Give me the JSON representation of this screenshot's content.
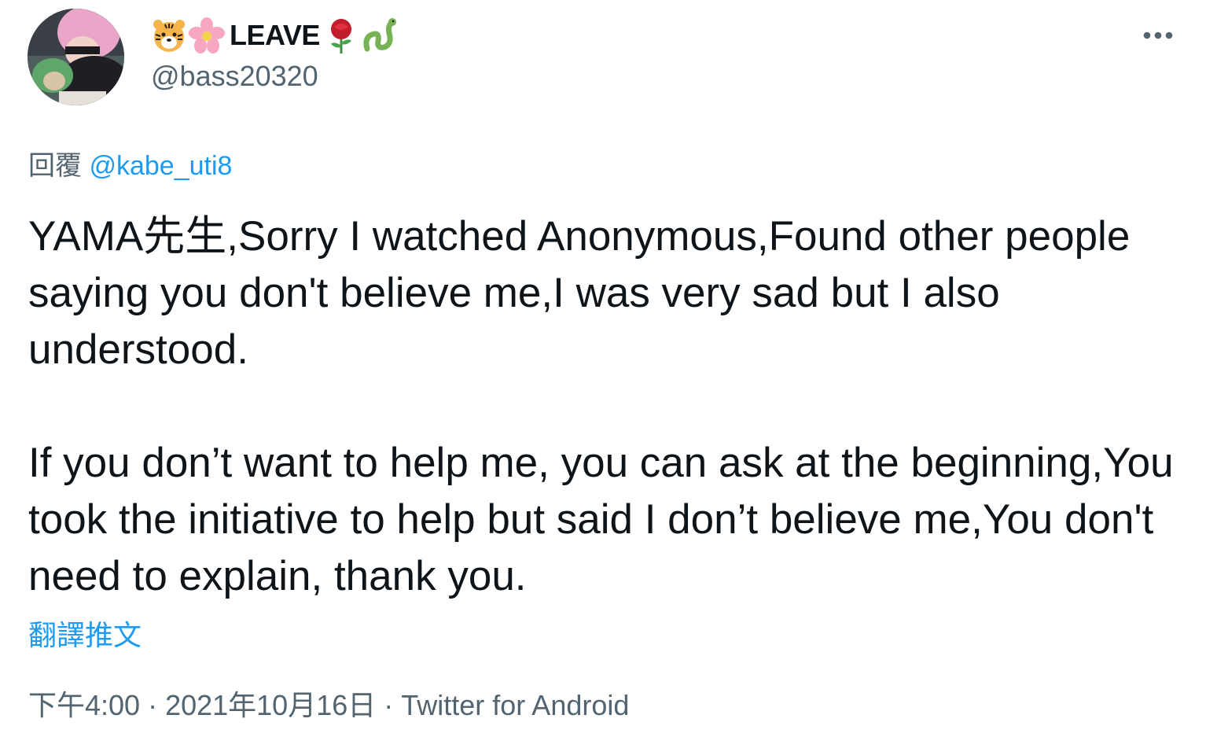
{
  "user": {
    "display_name": "LEAVE",
    "handle": "@bass20320",
    "name_emojis": [
      "tiger-face-emoji",
      "cherry-blossom-emoji",
      "rose-emoji",
      "snake-emoji"
    ]
  },
  "reply": {
    "prefix": "回覆",
    "mention": "@kabe_uti8"
  },
  "tweet": {
    "paragraph_1": "YAMA先生,Sorry I watched Anonymous,Found other people saying you don't believe me,I was very sad but I also understood.",
    "paragraph_2": "If you don’t want to help me, you can ask at the beginning,You took the initiative to help but said I don’t believe me,You don't need to explain, thank you.",
    "translate_label": "翻譯推文"
  },
  "meta": {
    "time": "下午4:00",
    "date": "2021年10月16日",
    "source": "Twitter for Android",
    "separator": "·"
  },
  "colors": {
    "text_primary": "#0f1419",
    "text_secondary": "#536471",
    "link": "#1d9bf0"
  }
}
